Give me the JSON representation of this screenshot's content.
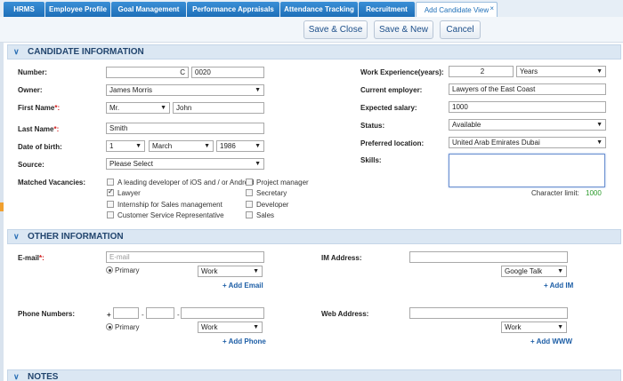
{
  "tabs": [
    {
      "label": "HRMS"
    },
    {
      "label": "Employee Profile"
    },
    {
      "label": "Goal Management"
    },
    {
      "label": "Performance Appraisals"
    },
    {
      "label": "Attendance Tracking"
    },
    {
      "label": "Recruitment"
    },
    {
      "label": "Add Candidate View"
    }
  ],
  "tab_close": "×",
  "toolbar": {
    "save_close": "Save & Close",
    "save_new": "Save & New",
    "cancel": "Cancel"
  },
  "sections": {
    "candidate": "CANDIDATE INFORMATION",
    "other": "OTHER INFORMATION",
    "notes": "NOTES"
  },
  "chevron": "∨",
  "arrow": "▼",
  "candidate": {
    "number_label": "Number:",
    "number_prefix": "C",
    "number_value": "0020",
    "owner_label": "Owner:",
    "owner_value": "James Morris",
    "first_name_label": "First Name",
    "title_value": "Mr.",
    "first_name_value": "John",
    "last_name_label": "Last Name",
    "last_name_value": "Smith",
    "dob_label": "Date of birth:",
    "dob_day": "1",
    "dob_month": "March",
    "dob_year": "1986",
    "source_label": "Source:",
    "source_value": "Please Select",
    "vacancies_label": "Matched Vacancies:",
    "vacancies": [
      {
        "label": "A leading developer of iOS and / or Android",
        "checked": false
      },
      {
        "label": "Project manager",
        "checked": false
      },
      {
        "label": "Lawyer",
        "checked": true
      },
      {
        "label": "Secretary",
        "checked": false
      },
      {
        "label": "Internship for Sales management",
        "checked": false
      },
      {
        "label": "Developer",
        "checked": false
      },
      {
        "label": "Customer Service Representative",
        "checked": false
      },
      {
        "label": "Sales",
        "checked": false
      }
    ],
    "required_mark": "*:",
    "work_exp_label": "Work Experience(years):",
    "work_exp_value": "2",
    "work_exp_unit": "Years",
    "employer_label": "Current employer:",
    "employer_value": "Lawyers of the East Coast",
    "salary_label": "Expected salary:",
    "salary_value": "1000",
    "status_label": "Status:",
    "status_value": "Available",
    "location_label": "Preferred location:",
    "location_value": "United Arab Emirates Dubai",
    "skills_label": "Skills:",
    "char_limit_label": "Character limit:",
    "char_limit_value": "1000"
  },
  "other": {
    "email_label": "E-mail",
    "email_placeholder": "E-mail",
    "primary": "Primary",
    "work": "Work",
    "add_email": "+ Add Email",
    "im_label": "IM Address:",
    "im_type": "Google Talk",
    "add_im": "+ Add IM",
    "phone_label": "Phone Numbers:",
    "plus": "+",
    "dash": "-",
    "add_phone": "+ Add Phone",
    "web_label": "Web Address:",
    "add_www": "+ Add WWW"
  }
}
